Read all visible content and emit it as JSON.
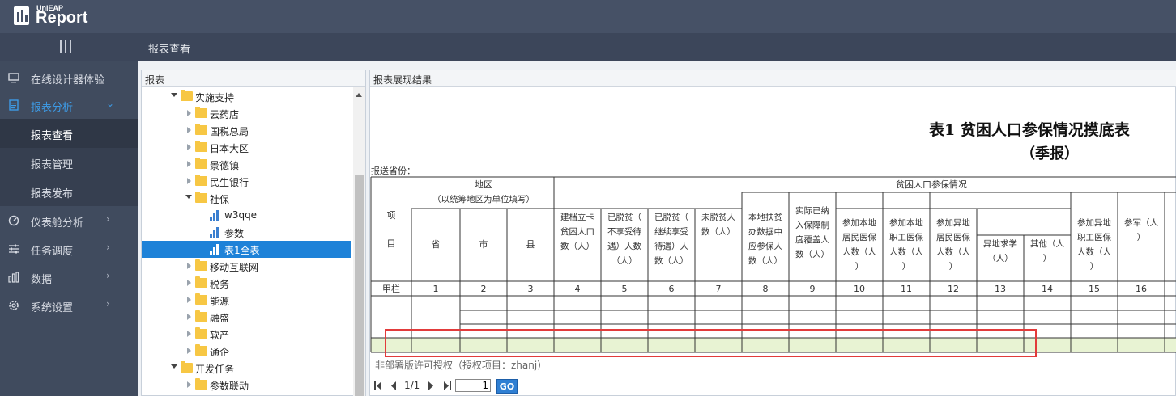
{
  "app": {
    "logo_small": "UniEAP",
    "logo_big": "Report"
  },
  "breadcrumb": "报表查看",
  "sidebar": {
    "items": [
      {
        "label": "在线设计器体验",
        "icon": "monitor-icon"
      },
      {
        "label": "报表分析",
        "icon": "report-icon",
        "expanded": true
      },
      {
        "label": "仪表舱分析",
        "icon": "gauge-icon"
      },
      {
        "label": "任务调度",
        "icon": "sliders-icon"
      },
      {
        "label": "数据",
        "icon": "bar-chart-icon"
      },
      {
        "label": "系统设置",
        "icon": "gear-icon"
      }
    ],
    "sub_items": [
      {
        "label": "报表查看",
        "active": true
      },
      {
        "label": "报表管理"
      },
      {
        "label": "报表发布"
      }
    ]
  },
  "tree": {
    "header": "报表",
    "nodes": [
      {
        "label": "实施支持",
        "type": "folder",
        "state": "open",
        "level": 0
      },
      {
        "label": "云药店",
        "type": "folder",
        "state": "closed",
        "level": 1
      },
      {
        "label": "国税总局",
        "type": "folder",
        "state": "closed",
        "level": 1
      },
      {
        "label": "日本大区",
        "type": "folder",
        "state": "closed",
        "level": 1
      },
      {
        "label": "景德镇",
        "type": "folder",
        "state": "closed",
        "level": 1
      },
      {
        "label": "民生银行",
        "type": "folder",
        "state": "closed",
        "level": 1
      },
      {
        "label": "社保",
        "type": "folder",
        "state": "open",
        "level": 1
      },
      {
        "label": "w3qqe",
        "type": "report",
        "level": 2
      },
      {
        "label": "参数",
        "type": "report",
        "level": 2
      },
      {
        "label": "表1全表",
        "type": "report",
        "level": 2,
        "selected": true
      },
      {
        "label": "移动互联网",
        "type": "folder",
        "state": "closed",
        "level": 1
      },
      {
        "label": "税务",
        "type": "folder",
        "state": "closed",
        "level": 1
      },
      {
        "label": "能源",
        "type": "folder",
        "state": "closed",
        "level": 1
      },
      {
        "label": "融盛",
        "type": "folder",
        "state": "closed",
        "level": 1
      },
      {
        "label": "软产",
        "type": "folder",
        "state": "closed",
        "level": 1
      },
      {
        "label": "通企",
        "type": "folder",
        "state": "closed",
        "level": 1
      },
      {
        "label": "开发任务",
        "type": "folder",
        "state": "open",
        "level": 0
      },
      {
        "label": "参数联动",
        "type": "folder",
        "state": "closed",
        "level": 1
      }
    ]
  },
  "result_panel": {
    "header": "报表展现结果"
  },
  "report": {
    "title": "表1  贫困人口参保情况摸底表",
    "subtitle": "（季报）",
    "province_label": "报送省份：",
    "col_item": "项目",
    "col_region": "地区",
    "col_region_note": "（以统筹地区为单位填写）",
    "col_poverty": "贫困人口参保情况",
    "col_prov": "省",
    "col_city": "市",
    "col_county": "县",
    "cols": [
      "建档立卡贫困人口数（人）",
      "已脱贫（不享受待遇）人数（人）",
      "已脱贫（继续享受待遇）人数（人）",
      "未脱贫人数（人）",
      "本地扶贫办数据中应参保人数（人）",
      "实际已纳入保障制度覆盖人数（人）",
      "参加本地居民医保人数（人）",
      "参加本地职工医保人数（人）",
      "参加异地居民医保人数（人）",
      "异地求学（人）",
      "其他（人）",
      "参加异地职工医保人数（人）",
      "参军（人）"
    ],
    "row_label": "甲栏",
    "col_numbers": [
      "1",
      "2",
      "3",
      "4",
      "5",
      "6",
      "7",
      "8",
      "9",
      "10",
      "11",
      "12",
      "13",
      "14",
      "15",
      "16"
    ]
  },
  "license": "非部署版许可授权（授权项目：zhanj）",
  "pager": {
    "page_text": "1/1",
    "page_value": "1",
    "go_label": "GO"
  }
}
